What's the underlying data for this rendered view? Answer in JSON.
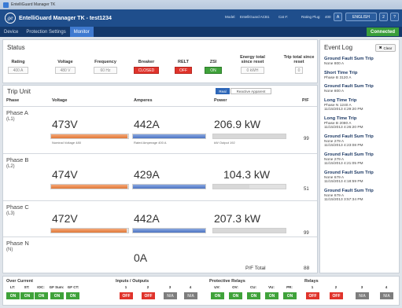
{
  "window": {
    "title": "EntelliGuard Manager TK"
  },
  "header": {
    "title": "EntelliGuard Manager TK - test1234",
    "model_label": "Model:",
    "model_value": "EntelliGuard ACB1",
    "cat_label": "Cat #:",
    "rating_label": "Rating Plug:",
    "rating_value": "400",
    "btn_a": "A",
    "btn_b": "ENGLISH",
    "btn_c": "2"
  },
  "tabs": [
    "Device",
    "Protection Settings",
    "Monitor"
  ],
  "connection_status": "Connected",
  "status": {
    "title": "Status",
    "fields": [
      {
        "label": "Rating",
        "value": "400 A",
        "style": "plain"
      },
      {
        "label": "Voltage",
        "value": "480 V",
        "style": "plain"
      },
      {
        "label": "Frequency",
        "value": "60 Hz",
        "style": "plain"
      },
      {
        "label": "Breaker",
        "value": "CLOSED",
        "style": "red"
      },
      {
        "label": "RELT",
        "value": "OFF",
        "style": "red"
      },
      {
        "label": "ZSI",
        "value": "ON",
        "style": "green"
      },
      {
        "label": "Energy total since reset",
        "value": "0 kWH",
        "style": "plain"
      },
      {
        "label": "Trip total since reset",
        "value": "0",
        "style": "plain"
      }
    ]
  },
  "trip_unit": {
    "title": "Trip Unit",
    "toggle_real": "Real",
    "toggle_reactive": "Reactive Apparent",
    "columns": {
      "phase": "Phase",
      "voltage": "Voltage",
      "amperes": "Amperes",
      "power": "Power",
      "pf": "P/F"
    },
    "phases": [
      {
        "name": "Phase A",
        "sub": "(L1)",
        "voltage": "473V",
        "voltage_caption": "Nominal Voltage 480",
        "voltage_level": 0.985,
        "amperes": "442A",
        "amperes_caption": "Rated Amperage 400 A",
        "amperes_level": 1.0,
        "power": "206.9 kW",
        "power_caption": "kW Output 192",
        "power_level": 1.0,
        "pf": "99"
      },
      {
        "name": "Phase B",
        "sub": "(L2)",
        "voltage": "474V",
        "voltage_caption": "",
        "voltage_level": 0.987,
        "amperes": "429A",
        "amperes_caption": "",
        "amperes_level": 1.0,
        "power": "104.3 kW",
        "power_caption": "",
        "power_level": 0.5,
        "pf": "51"
      },
      {
        "name": "Phase C",
        "sub": "(L3)",
        "voltage": "472V",
        "voltage_caption": "",
        "voltage_level": 0.983,
        "amperes": "442A",
        "amperes_caption": "",
        "amperes_level": 1.0,
        "power": "207.3 kW",
        "power_caption": "",
        "power_level": 1.0,
        "pf": "99"
      },
      {
        "name": "Phase N",
        "sub": "(N)",
        "voltage": "",
        "amperes": "0A",
        "power": "",
        "pf": ""
      }
    ],
    "pf_total_label": "P/F Total",
    "pf_total": "88"
  },
  "event_log": {
    "title": "Event Log",
    "clear_label": "Clear",
    "events": [
      {
        "title": "Ground Fault Sum Trip",
        "lines": [
          "None        800 A"
        ]
      },
      {
        "title": "Short Time Trip",
        "lines": [
          "Phase B  3120 A"
        ]
      },
      {
        "title": "Ground Fault Sum Trip",
        "lines": [
          "None        800 A"
        ]
      },
      {
        "title": "Long Time Trip",
        "lines": [
          "Phase N     1240 A",
          "11/15/2013 4:29:20 PM"
        ]
      },
      {
        "title": "Long Time Trip",
        "lines": [
          "Phase B     2080 A",
          "11/15/2013 4:26:20 PM"
        ]
      },
      {
        "title": "Ground Fault Sum Trip",
        "lines": [
          "None         279 A",
          "11/15/2013 4:23:08 PM"
        ]
      },
      {
        "title": "Ground Fault Sum Trip",
        "lines": [
          "None         279 A",
          "11/15/2013 4:21:05 PM"
        ]
      },
      {
        "title": "Ground Fault Sum Trip",
        "lines": [
          "None         679 A",
          "11/15/2013 4:18:59 PM"
        ]
      },
      {
        "title": "Ground Fault Sum Trip",
        "lines": [
          "None         679 A",
          "11/15/2013 3:57:34 PM"
        ]
      }
    ]
  },
  "footer": {
    "groups": [
      {
        "title": "Over Current",
        "items": [
          {
            "label": "LT:",
            "state": "ON"
          },
          {
            "label": "ST:",
            "state": "ON"
          },
          {
            "label": "IOC:",
            "state": "ON"
          },
          {
            "label": "GF Sum:",
            "state": "ON"
          },
          {
            "label": "GF CT:",
            "state": "ON"
          }
        ]
      },
      {
        "title": "Inputs / Outputs",
        "items": [
          {
            "label": "1",
            "state": "OFF"
          },
          {
            "label": "2",
            "state": "OFF"
          },
          {
            "label": "3",
            "state": "N/A"
          },
          {
            "label": "4",
            "state": "N/A"
          }
        ]
      },
      {
        "title": "Protective Relays",
        "items": [
          {
            "label": "UV:",
            "state": "ON"
          },
          {
            "label": "OV:",
            "state": "ON"
          },
          {
            "label": "CU:",
            "state": "ON"
          },
          {
            "label": "VU:",
            "state": "ON"
          },
          {
            "label": "PR:",
            "state": "ON"
          }
        ]
      },
      {
        "title": "Relays",
        "items": [
          {
            "label": "1",
            "state": "OFF"
          },
          {
            "label": "2",
            "state": "OFF"
          },
          {
            "label": "3",
            "state": "N/A"
          },
          {
            "label": "4",
            "state": "N/A"
          }
        ]
      }
    ]
  },
  "colors": {
    "header": "#1f4e8c",
    "tab_active": "#3f7ad0",
    "on": "#3fa23a",
    "off": "#e0332b",
    "na": "#7d7d7d",
    "voltage_bar": "#e07838",
    "amps_bar": "#4c73c2"
  }
}
